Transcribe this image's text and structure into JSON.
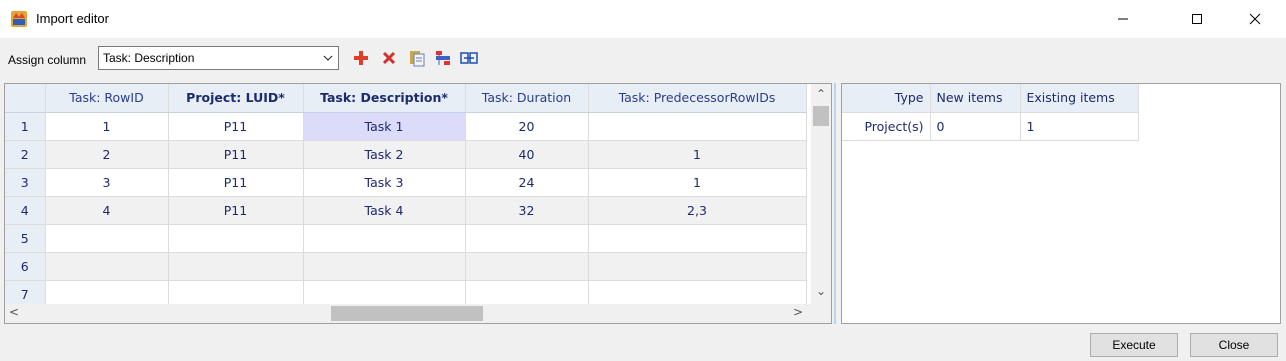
{
  "window": {
    "title": "Import editor"
  },
  "toolbar": {
    "assign_label": "Assign column",
    "combo_value": "Task: Description",
    "icons": [
      "add-icon",
      "delete-icon",
      "paste-icon",
      "reorder-icon",
      "swap-columns-icon"
    ]
  },
  "grid": {
    "columns": [
      "Task: RowID",
      "Project: LUID*",
      "Task: Description*",
      "Task: Duration",
      "Task: PredecessorRowIDs"
    ],
    "rows": [
      {
        "no": "1",
        "cells": [
          "1",
          "P11",
          "Task 1",
          "20",
          ""
        ]
      },
      {
        "no": "2",
        "cells": [
          "2",
          "P11",
          "Task 2",
          "40",
          "1"
        ]
      },
      {
        "no": "3",
        "cells": [
          "3",
          "P11",
          "Task 3",
          "24",
          "1"
        ]
      },
      {
        "no": "4",
        "cells": [
          "4",
          "P11",
          "Task 4",
          "32",
          "2,3"
        ]
      },
      {
        "no": "5",
        "cells": [
          "",
          "",
          "",
          "",
          ""
        ]
      },
      {
        "no": "6",
        "cells": [
          "",
          "",
          "",
          "",
          ""
        ]
      },
      {
        "no": "7",
        "cells": [
          "",
          "",
          "",
          "",
          ""
        ]
      }
    ]
  },
  "summary": {
    "columns": [
      "Type",
      "New items",
      "Existing items"
    ],
    "rows": [
      {
        "type": "Project(s)",
        "new": "0",
        "existing": "1"
      }
    ]
  },
  "buttons": {
    "execute": "Execute",
    "close": "Close"
  },
  "colors": {
    "header_bg": "#e8eef6",
    "text_blue": "#1c2a6e",
    "selection": "#dcdcfa",
    "add_red": "#e03c28"
  }
}
